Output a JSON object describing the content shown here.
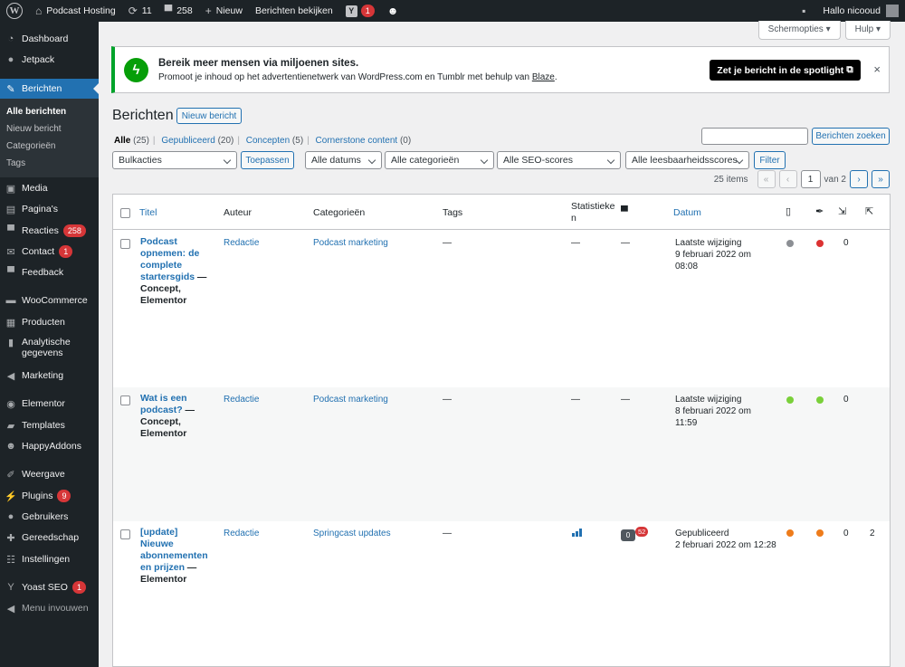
{
  "adminbar": {
    "site_name": "Podcast Hosting",
    "updates_count": "11",
    "comments_count": "258",
    "new_label": "Nieuw",
    "view_posts_label": "Berichten bekijken",
    "yoast_badge": "1",
    "greeting": "Hallo nicooud"
  },
  "sidebar": {
    "items": [
      {
        "label": "Dashboard"
      },
      {
        "label": "Jetpack"
      },
      {
        "label": "Berichten"
      },
      {
        "label": "Media"
      },
      {
        "label": "Pagina's"
      },
      {
        "label": "Reacties",
        "badge": "258"
      },
      {
        "label": "Contact",
        "badge": "1"
      },
      {
        "label": "Feedback"
      },
      {
        "label": "WooCommerce"
      },
      {
        "label": "Producten"
      },
      {
        "label": "Analytische gegevens"
      },
      {
        "label": "Marketing"
      },
      {
        "label": "Elementor"
      },
      {
        "label": "Templates"
      },
      {
        "label": "HappyAddons"
      },
      {
        "label": "Weergave"
      },
      {
        "label": "Plugins",
        "badge": "9"
      },
      {
        "label": "Gebruikers"
      },
      {
        "label": "Gereedschap"
      },
      {
        "label": "Instellingen"
      },
      {
        "label": "Yoast SEO",
        "badge": "1"
      },
      {
        "label": "Menu invouwen"
      }
    ],
    "submenu": [
      "Alle berichten",
      "Nieuw bericht",
      "Categorieën",
      "Tags"
    ]
  },
  "screen_meta": {
    "options_label": "Schermopties",
    "help_label": "Hulp"
  },
  "notice": {
    "title": "Bereik meer mensen via miljoenen sites.",
    "desc_prefix": "Promoot je inhoud op het advertentienetwerk van WordPress.com en Tumblr met behulp van ",
    "desc_link": "Blaze",
    "desc_suffix": ".",
    "cta_label": "Zet je bericht in de spotlight",
    "close": "×"
  },
  "page": {
    "title": "Berichten",
    "add_new_label": "Nieuw bericht",
    "views": [
      {
        "label": "Alle",
        "count": "(25)"
      },
      {
        "label": "Gepubliceerd",
        "count": "(20)"
      },
      {
        "label": "Concepten",
        "count": "(5)"
      },
      {
        "label": "Cornerstone content",
        "count": "(0)"
      }
    ],
    "search_button": "Berichten zoeken",
    "search_placeholder": ""
  },
  "filters": {
    "bulk": "Bulkacties",
    "apply": "Toepassen",
    "dates": "Alle datums",
    "categories": "Alle categorieën",
    "seo": "Alle SEO-scores",
    "readability": "Alle leesbaarheidsscores",
    "filter": "Filter"
  },
  "pagination": {
    "items": "25 items",
    "first": "«",
    "prev": "‹",
    "current": "1",
    "of": "van 2",
    "next": "›",
    "last": "»"
  },
  "table": {
    "headers": {
      "title": "Titel",
      "author": "Auteur",
      "categories": "Categorieën",
      "tags": "Tags",
      "stats": "Statistieken",
      "date": "Datum"
    },
    "rows": [
      {
        "title": "Podcast opnemen: de complete startersgids",
        "state": "— Concept, Elementor",
        "author": "Redactie",
        "category": "Podcast marketing",
        "tags": "—",
        "stats": "—",
        "comments": "—",
        "date_status": "Laatste wijziging",
        "date": "9 februari 2022 om 08:08",
        "seo_color": "#8c8f94",
        "read_color": "#dc3232",
        "links_in": "0",
        "links_out": ""
      },
      {
        "title": "Wat is een podcast?",
        "state": "— Concept, Elementor",
        "author": "Redactie",
        "category": "Podcast marketing",
        "tags": "—",
        "stats": "—",
        "comments": "—",
        "date_status": "Laatste wijziging",
        "date": "8 februari 2022 om 11:59",
        "seo_color": "#7ad03a",
        "read_color": "#7ad03a",
        "links_in": "0",
        "links_out": ""
      },
      {
        "title": "[update] Nieuwe abonnementen en prijzen",
        "state": "— Elementor",
        "author": "Redactie",
        "category": "Springcast updates",
        "tags": "—",
        "comments_approved": "0",
        "comments_pending": "52",
        "date_status": "Gepubliceerd",
        "date": "2 februari 2022 om 12:28",
        "seo_color": "#ee7c1b",
        "read_color": "#ee7c1b",
        "links_in": "0",
        "links_out": "2"
      }
    ]
  },
  "colors": {
    "accent": "#2271b1",
    "adminbar": "#1d2327",
    "badge": "#d63638",
    "notice_border": "#00a32a"
  }
}
